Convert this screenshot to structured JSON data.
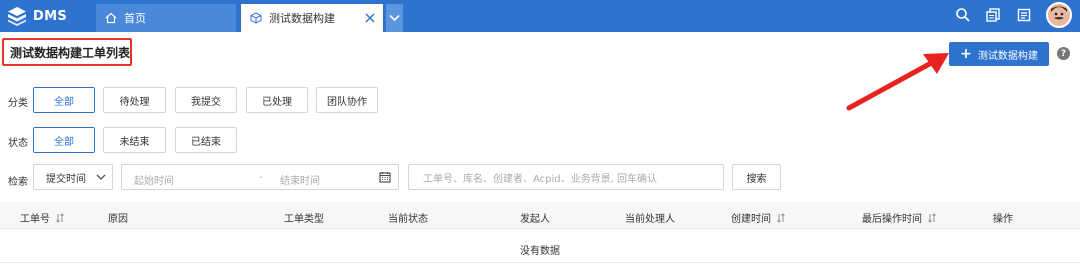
{
  "app": {
    "name": "DMS"
  },
  "tabs": [
    {
      "label": "首页",
      "icon": "home-icon"
    },
    {
      "label": "测试数据构建",
      "icon": "cube-icon"
    }
  ],
  "header_icons": [
    "search-icon",
    "copy-icon",
    "document-icon",
    "avatar"
  ],
  "page": {
    "title": "测试数据构建工单列表",
    "create_button": "测试数据构建",
    "help": "?"
  },
  "filters": {
    "category_label": "分类",
    "category_options": [
      "全部",
      "待处理",
      "我提交",
      "已处理",
      "团队协作"
    ],
    "category_selected": "全部",
    "status_label": "状态",
    "status_options": [
      "全部",
      "未结束",
      "已结束"
    ],
    "status_selected": "全部",
    "search_label": "检索",
    "time_field": "提交时间",
    "start_placeholder": "起始时间",
    "range_separator": "-",
    "end_placeholder": "结束时间",
    "keyword_placeholder": "工单号、库名、创建者、Acpid、业务背景, 回车确认",
    "search_button": "搜索"
  },
  "table": {
    "columns": [
      "工单号",
      "原因",
      "工单类型",
      "当前状态",
      "发起人",
      "当前处理人",
      "创建时间",
      "最后操作时间",
      "操作"
    ],
    "empty_text": "没有数据"
  },
  "colors": {
    "primary": "#2d73cf",
    "highlight": "#e5322d",
    "arrow": "#e8221e"
  }
}
